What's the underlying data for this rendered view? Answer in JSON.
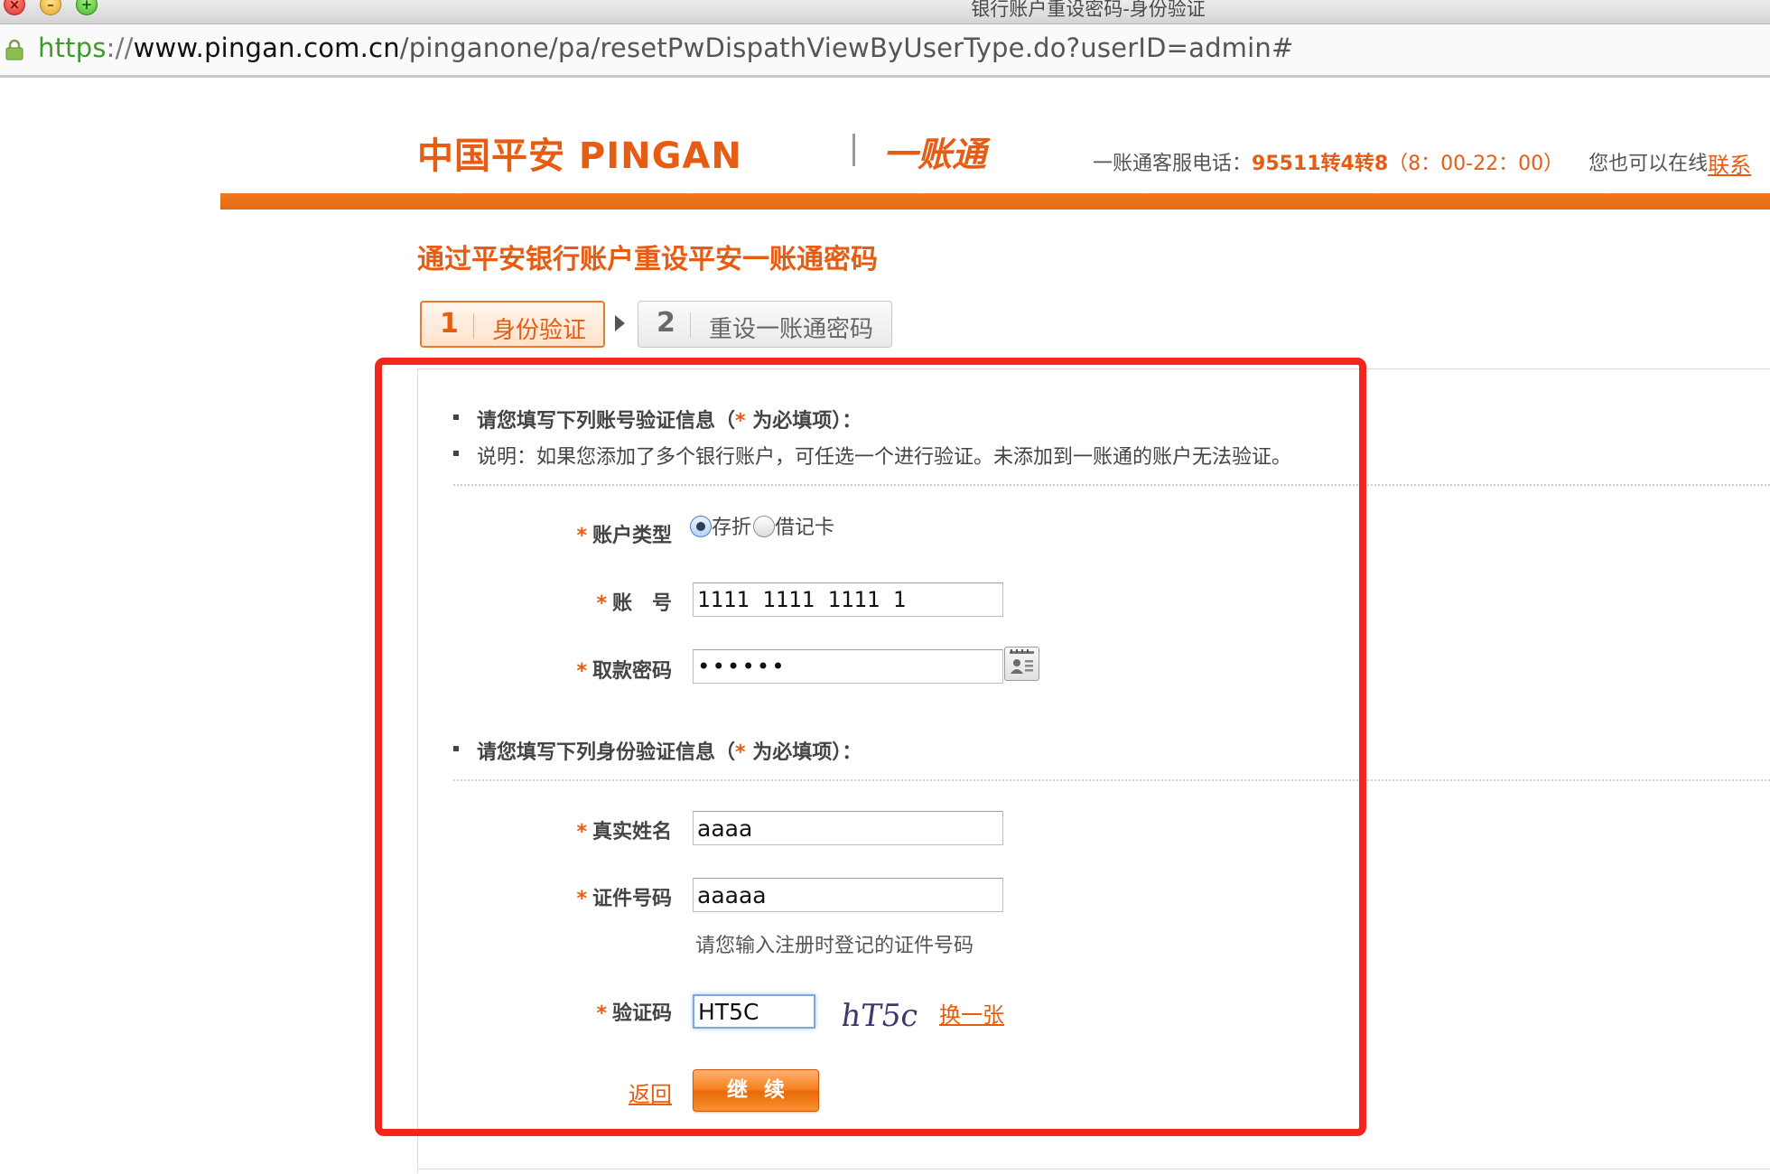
{
  "window": {
    "title": "银行账户重设密码-身份验证"
  },
  "address_bar": {
    "scheme": "https",
    "separator": "://",
    "host": "www.pingan.com.cn",
    "path": "/pinganone/pa/resetPwDispathViewByUserType.do?userID=admin#"
  },
  "header": {
    "logo_text": "中国平安 PINGAN",
    "product_logo": "一账通",
    "hotline_label": "一账通客服电话：",
    "hotline_number": "95511转4转8",
    "hotline_hours": "（8：00-22：00）",
    "online_text": "您也可以在线",
    "online_link": "联系"
  },
  "page_title": "通过平安银行账户重设平安一账通密码",
  "steps": [
    {
      "num": "1",
      "label": "身份验证",
      "active": true
    },
    {
      "num": "2",
      "label": "重设一账通密码",
      "active": false
    }
  ],
  "account_section": {
    "instruction_prefix": "请您填写下列账号验证信息（",
    "instruction_star": "*",
    "instruction_suffix": " 为必填项）：",
    "note": "说明：如果您添加了多个银行账户，可任选一个进行验证。未添加到一账通的账户无法验证。"
  },
  "form": {
    "required_mark": "*",
    "account_type": {
      "label": "账户类型",
      "options": [
        "存折",
        "借记卡"
      ],
      "selected": "存折"
    },
    "account_number": {
      "label": "账　号",
      "value": "1111 1111 1111 1"
    },
    "withdraw_password": {
      "label": "取款密码",
      "value": "••••••"
    }
  },
  "identity_section": {
    "instruction_prefix": "请您填写下列身份验证信息（",
    "instruction_star": "*",
    "instruction_suffix": " 为必填项）："
  },
  "identity_form": {
    "real_name": {
      "label": "真实姓名",
      "value": "aaaa"
    },
    "id_number": {
      "label": "证件号码",
      "value": "aaaaa",
      "hint": "请您输入注册时登记的证件号码"
    },
    "captcha": {
      "label": "验证码",
      "value": "HT5C",
      "image_text": "hT5c",
      "refresh_link": "换一张"
    }
  },
  "actions": {
    "back": "返回",
    "continue": "继续"
  },
  "colors": {
    "brand_orange": "#e65c12",
    "annotation_red": "#f3261c"
  }
}
